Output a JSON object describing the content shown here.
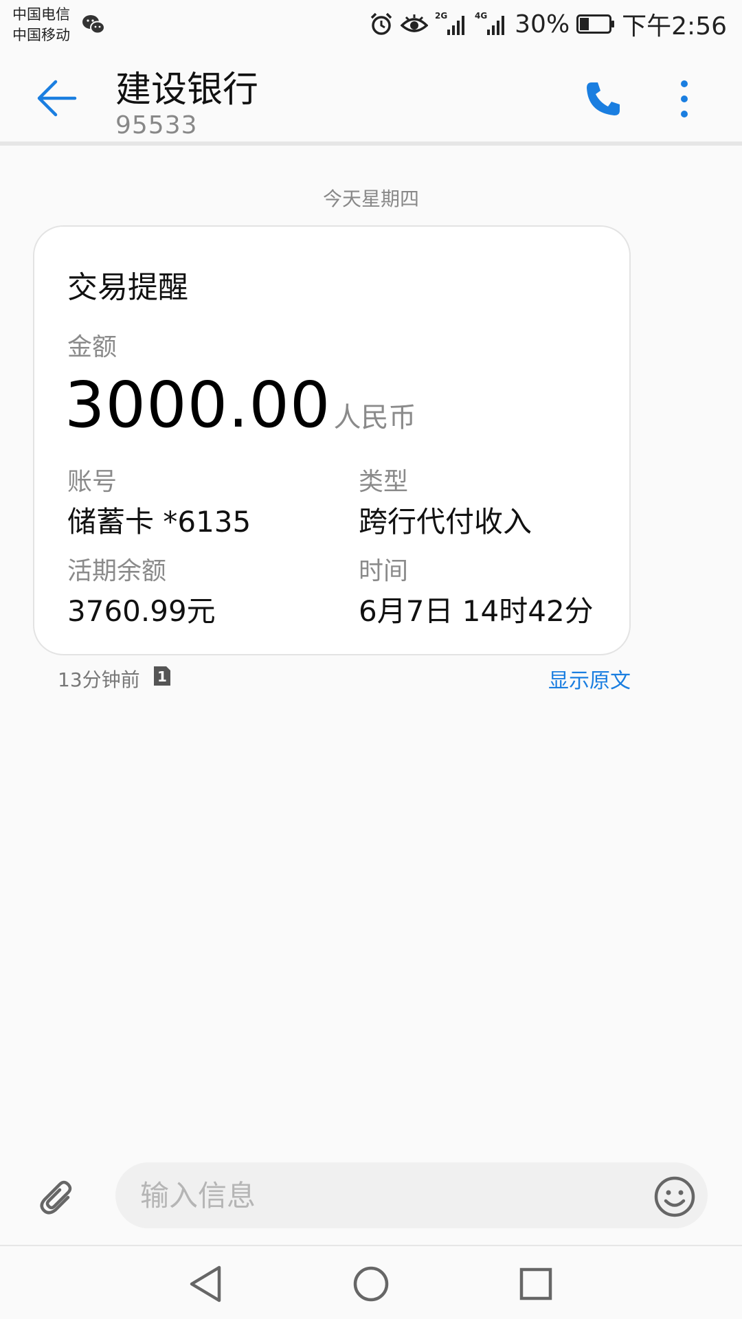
{
  "status_bar": {
    "carrier_1": "中国电信",
    "carrier_2": "中国移动",
    "network_1": "2G",
    "network_2": "4G",
    "battery": "30%",
    "time": "下午2:56",
    "icons": [
      "wechat-icon",
      "alarm-icon",
      "eye-icon",
      "signal-icon",
      "battery-icon"
    ]
  },
  "app_bar": {
    "title": "建设银行",
    "subtitle": "95533",
    "accent_color": "#1a7ee0"
  },
  "conversation": {
    "date_label": "今天星期四",
    "card": {
      "title": "交易提醒",
      "amount_label": "金额",
      "amount_value": "3000.00",
      "amount_unit": "人民币",
      "fields": [
        {
          "label": "账号",
          "value": "储蓄卡 *6135"
        },
        {
          "label": "类型",
          "value": "跨行代付收入"
        },
        {
          "label": "活期余额",
          "value": "3760.99元"
        },
        {
          "label": "时间",
          "value": "6月7日 14时42分"
        }
      ]
    },
    "meta": {
      "time_ago": "13分钟前",
      "sim": "1",
      "show_original": "显示原文"
    }
  },
  "composer": {
    "placeholder": "输入信息"
  }
}
